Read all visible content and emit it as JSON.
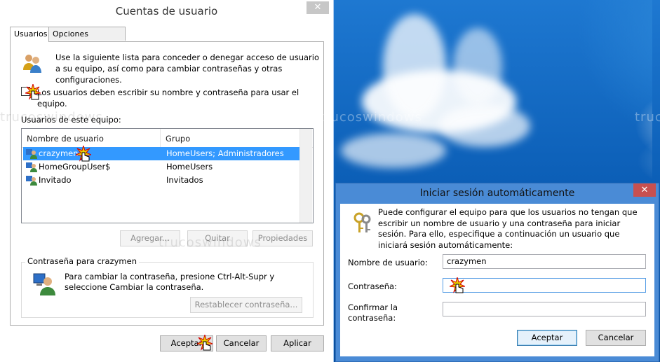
{
  "main_window": {
    "title": "Cuentas de usuario",
    "close_label": "✕",
    "tabs": [
      "Usuarios",
      "Opciones avanzadas"
    ],
    "intro": "Use la siguiente lista para conceder o denegar acceso de usuario a su equipo, así como para cambiar contraseñas y otras configuraciones.",
    "checkbox_label": "Los usuarios deben escribir su nombre y contraseña para usar el equipo.",
    "checkbox_checked": false,
    "users_label": "Usuarios de este equipo:",
    "columns": [
      "Nombre de usuario",
      "Grupo"
    ],
    "users": [
      {
        "name": "crazymen",
        "group": "HomeUsers; Administradores",
        "selected": true
      },
      {
        "name": "HomeGroupUser$",
        "group": "HomeUsers",
        "selected": false
      },
      {
        "name": "Invitado",
        "group": "Invitados",
        "selected": false
      }
    ],
    "list_buttons": {
      "add": "Agregar...",
      "remove": "Quitar",
      "properties": "Propiedades"
    },
    "password_group_label": "Contraseña para crazymen",
    "password_text": "Para cambiar la contraseña, presione Ctrl-Alt-Supr y seleccione Cambiar la contraseña.",
    "reset_button": "Restablecer contraseña...",
    "footer": {
      "ok": "Aceptar",
      "cancel": "Cancelar",
      "apply": "Aplicar"
    }
  },
  "autologon_dialog": {
    "title": "Iniciar sesión automáticamente",
    "close_label": "✕",
    "description": "Puede configurar el equipo para que los usuarios no tengan que escribir un nombre de usuario y una contraseña para iniciar sesión. Para ello, especifique a continuación un usuario que iniciará sesión automáticamente:",
    "username_label": "Nombre de usuario:",
    "username_value": "crazymen",
    "password_label": "Contraseña:",
    "password_value": "",
    "confirm_label_1": "Confirmar la",
    "confirm_label_2": "contraseña:",
    "confirm_value": "",
    "ok": "Aceptar",
    "cancel": "Cancelar"
  },
  "watermark": "trucoswindows",
  "colors": {
    "selection": "#3399ff",
    "close_active": "#c75050",
    "dialog_frame": "#4a8bd6"
  }
}
